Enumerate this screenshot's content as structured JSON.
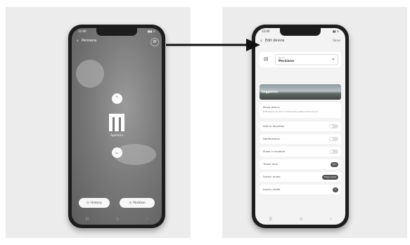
{
  "left_phone": {
    "status_time": "12:00",
    "status_right": "▮▮▮ ⊝",
    "back_icon": "‹",
    "title": "Persiana",
    "gear_glyph": "⚙",
    "up_glyph": "⌃",
    "down_glyph": "⌄",
    "shutter_label": "Apertura",
    "history_label": "History",
    "position_label": "Position",
    "history_glyph": "◷",
    "position_glyph": "◷",
    "nav": [
      "◫",
      "○",
      "‹"
    ]
  },
  "right_phone": {
    "status_time": "12:00",
    "status_right": "▮▮ ⊝",
    "back_icon": "‹",
    "title": "Edit device",
    "save_label": "Save",
    "name_caption": "Name",
    "name_value": "Persiana",
    "clear_glyph": "✕",
    "device_glyph": "▤",
    "photo_label": "Soggiorno",
    "device_section_title": "Move device",
    "device_section_text": "Edit device for floor to follow the state of the device.",
    "rows": [
      {
        "label": "Add to favorites",
        "control": "toggle"
      },
      {
        "label": "Notifications",
        "control": "toggle"
      },
      {
        "label": "Show in location",
        "control": "toggle"
      },
      {
        "label": "Travel time",
        "control": "pill",
        "value": "35s"
      },
      {
        "label": "Switch mode",
        "control": "pill",
        "value": "Edge mode"
      },
      {
        "label": "Inputs_mode",
        "control": "pill",
        "value": "1"
      }
    ],
    "nav": [
      "◫",
      "○",
      "‹"
    ]
  }
}
